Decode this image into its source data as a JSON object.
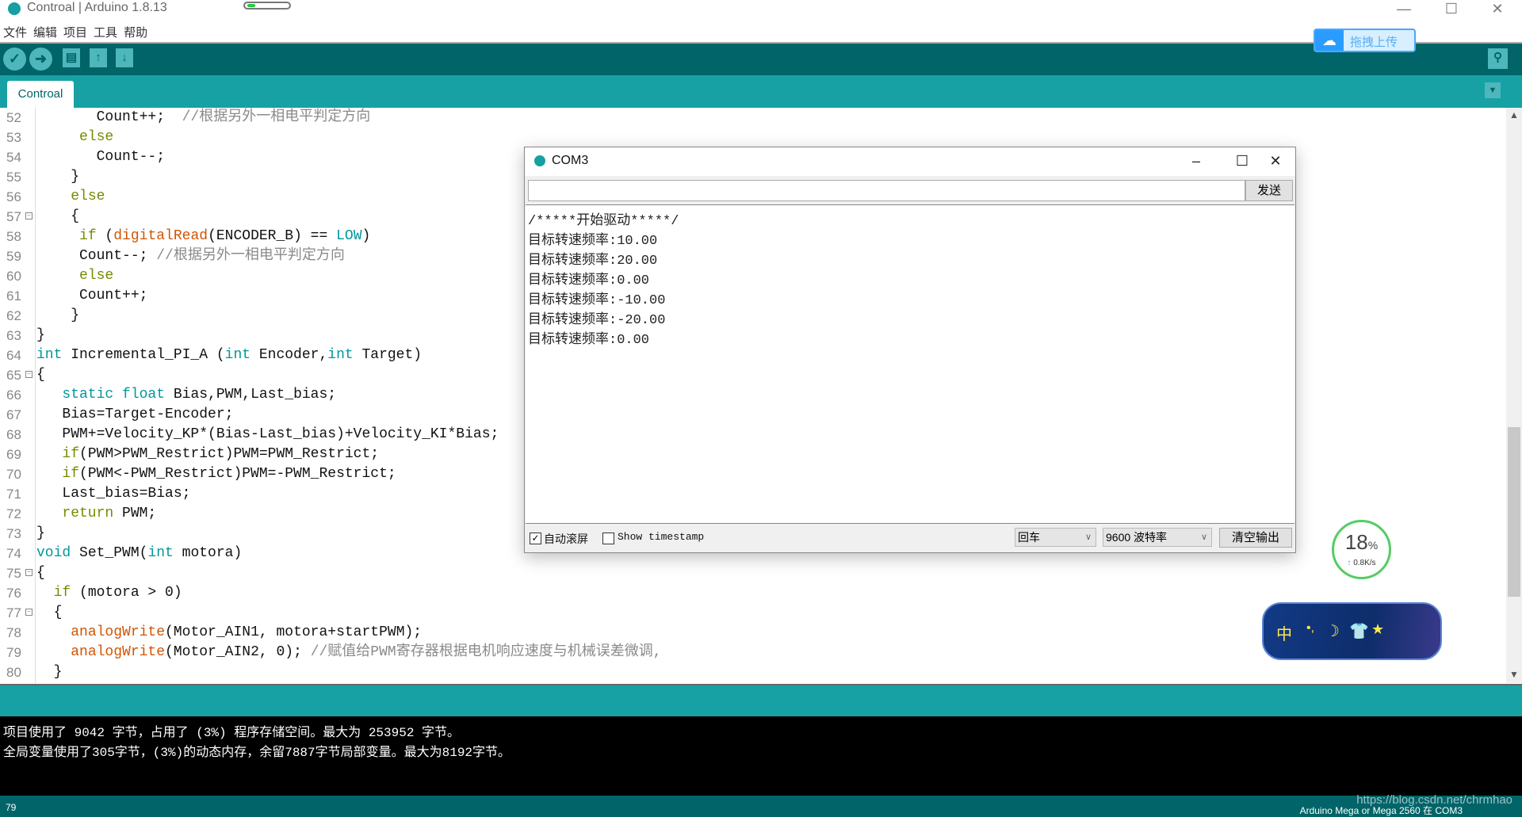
{
  "window": {
    "title": "Controal | Arduino 1.8.13",
    "progress": 0.2
  },
  "menu": [
    "文件",
    "编辑",
    "项目",
    "工具",
    "帮助"
  ],
  "toolbar": {
    "verify": "verify-icon",
    "upload": "upload-arrow-icon",
    "new": "new-file-icon",
    "open": "open-icon",
    "save": "save-icon",
    "serial_monitor": "serial-monitor-icon"
  },
  "baidu_upload": {
    "label": "拖拽上传"
  },
  "tab": {
    "label": "Controal"
  },
  "editor": {
    "lines": [
      {
        "n": "52",
        "seg": [
          [
            "       Count++;  ",
            ""
          ],
          [
            "//根据另外一相电平判定方向",
            "cm"
          ]
        ]
      },
      {
        "n": "53",
        "seg": [
          [
            "     ",
            ""
          ],
          [
            "else",
            "ctl"
          ]
        ]
      },
      {
        "n": "54",
        "seg": [
          [
            "       Count--;",
            ""
          ]
        ]
      },
      {
        "n": "55",
        "seg": [
          [
            "    }",
            ""
          ]
        ]
      },
      {
        "n": "56",
        "seg": [
          [
            "    ",
            ""
          ],
          [
            "else",
            "ctl"
          ]
        ]
      },
      {
        "n": "57",
        "fold": true,
        "seg": [
          [
            "    {",
            ""
          ]
        ]
      },
      {
        "n": "58",
        "seg": [
          [
            "     ",
            ""
          ],
          [
            "if",
            "ctl"
          ],
          [
            " (",
            ""
          ],
          [
            "digitalRead",
            "fn"
          ],
          [
            "(ENCODER_B) == ",
            ""
          ],
          [
            "LOW",
            "kw"
          ],
          [
            ")",
            ""
          ]
        ]
      },
      {
        "n": "59",
        "seg": [
          [
            "     Count--; ",
            ""
          ],
          [
            "//根据另外一相电平判定方向",
            "cm"
          ]
        ]
      },
      {
        "n": "60",
        "seg": [
          [
            "     ",
            ""
          ],
          [
            "else",
            "ctl"
          ]
        ]
      },
      {
        "n": "61",
        "seg": [
          [
            "     Count++;",
            ""
          ]
        ]
      },
      {
        "n": "62",
        "seg": [
          [
            "    }",
            ""
          ]
        ]
      },
      {
        "n": "63",
        "seg": [
          [
            "}",
            ""
          ]
        ]
      },
      {
        "n": "64",
        "seg": [
          [
            "int",
            "kw"
          ],
          [
            " Incremental_PI_A (",
            ""
          ],
          [
            "int",
            "kw"
          ],
          [
            " Encoder,",
            ""
          ],
          [
            "int",
            "kw"
          ],
          [
            " Target)",
            ""
          ]
        ]
      },
      {
        "n": "65",
        "fold": true,
        "seg": [
          [
            "{",
            ""
          ]
        ]
      },
      {
        "n": "66",
        "seg": [
          [
            "   ",
            ""
          ],
          [
            "static",
            "kw"
          ],
          [
            " ",
            ""
          ],
          [
            "float",
            "kw"
          ],
          [
            " Bias,PWM,Last_bias;",
            ""
          ]
        ]
      },
      {
        "n": "67",
        "seg": [
          [
            "   Bias=Target-Encoder;",
            ""
          ]
        ]
      },
      {
        "n": "68",
        "seg": [
          [
            "   PWM+=Velocity_KP*(Bias-Last_bias)+Velocity_KI*Bias;",
            ""
          ]
        ]
      },
      {
        "n": "69",
        "seg": [
          [
            "   ",
            ""
          ],
          [
            "if",
            "ctl"
          ],
          [
            "(PWM>PWM_Restrict)PWM=PWM_Restrict;",
            ""
          ]
        ]
      },
      {
        "n": "70",
        "seg": [
          [
            "   ",
            ""
          ],
          [
            "if",
            "ctl"
          ],
          [
            "(PWM<-PWM_Restrict)PWM=-PWM_Restrict;",
            ""
          ]
        ]
      },
      {
        "n": "71",
        "seg": [
          [
            "   Last_bias=Bias;",
            ""
          ]
        ]
      },
      {
        "n": "72",
        "seg": [
          [
            "   ",
            ""
          ],
          [
            "return",
            "ctl"
          ],
          [
            " PWM;",
            ""
          ]
        ]
      },
      {
        "n": "73",
        "seg": [
          [
            "}",
            ""
          ]
        ]
      },
      {
        "n": "74",
        "seg": [
          [
            "void",
            "kw"
          ],
          [
            " Set_PWM(",
            ""
          ],
          [
            "int",
            "kw"
          ],
          [
            " motora)",
            ""
          ]
        ]
      },
      {
        "n": "75",
        "fold": true,
        "seg": [
          [
            "{",
            ""
          ]
        ]
      },
      {
        "n": "76",
        "seg": [
          [
            "  ",
            ""
          ],
          [
            "if",
            "ctl"
          ],
          [
            " (motora > 0)",
            ""
          ]
        ]
      },
      {
        "n": "77",
        "fold": true,
        "seg": [
          [
            "  {",
            ""
          ]
        ]
      },
      {
        "n": "78",
        "seg": [
          [
            "    ",
            ""
          ],
          [
            "analogWrite",
            "fn"
          ],
          [
            "(Motor_AIN1, motora+startPWM);",
            ""
          ]
        ]
      },
      {
        "n": "79",
        "seg": [
          [
            "    ",
            ""
          ],
          [
            "analogWrite",
            "fn"
          ],
          [
            "(Motor_AIN2, 0); ",
            ""
          ],
          [
            "//赋值给PWM寄存器根据电机响应速度与机械误差微调,",
            "cm"
          ]
        ]
      },
      {
        "n": "80",
        "seg": [
          [
            "  }",
            ""
          ]
        ]
      }
    ]
  },
  "console": {
    "lines": [
      "项目使用了 9042 字节，占用了 (3%) 程序存储空间。最大为 253952 字节。",
      "全局变量使用了305字节，(3%)的动态内存，余留7887字节局部变量。最大为8192字节。"
    ]
  },
  "statusbar": {
    "line": "79",
    "board": "Arduino Mega or Mega 2560 在 COM3",
    "watermark": "https://blog.csdn.net/chrmhao"
  },
  "serial_monitor": {
    "title": "COM3",
    "input_value": "",
    "send_label": "发送",
    "output": [
      "/*****开始驱动*****/",
      "目标转速频率:10.00",
      "目标转速频率:20.00",
      "目标转速频率:0.00",
      "目标转速频率:-10.00",
      "目标转速频率:-20.00",
      "目标转速频率:0.00"
    ],
    "autoscroll_label": "自动滚屏",
    "autoscroll_checked": true,
    "timestamp_label": "Show timestamp",
    "timestamp_checked": false,
    "line_ending": "回车",
    "baud": "9600 波特率",
    "clear_label": "清空输出"
  },
  "net_widget": {
    "percent": "18",
    "percent_sign": "%",
    "speed": "0.8K/s"
  },
  "ime_widget": {
    "mode": "中"
  },
  "colors": {
    "toolbar": "#006468",
    "tabbar": "#17a1a5",
    "keyword": "#00979c",
    "control": "#728e00",
    "function": "#d35400"
  }
}
